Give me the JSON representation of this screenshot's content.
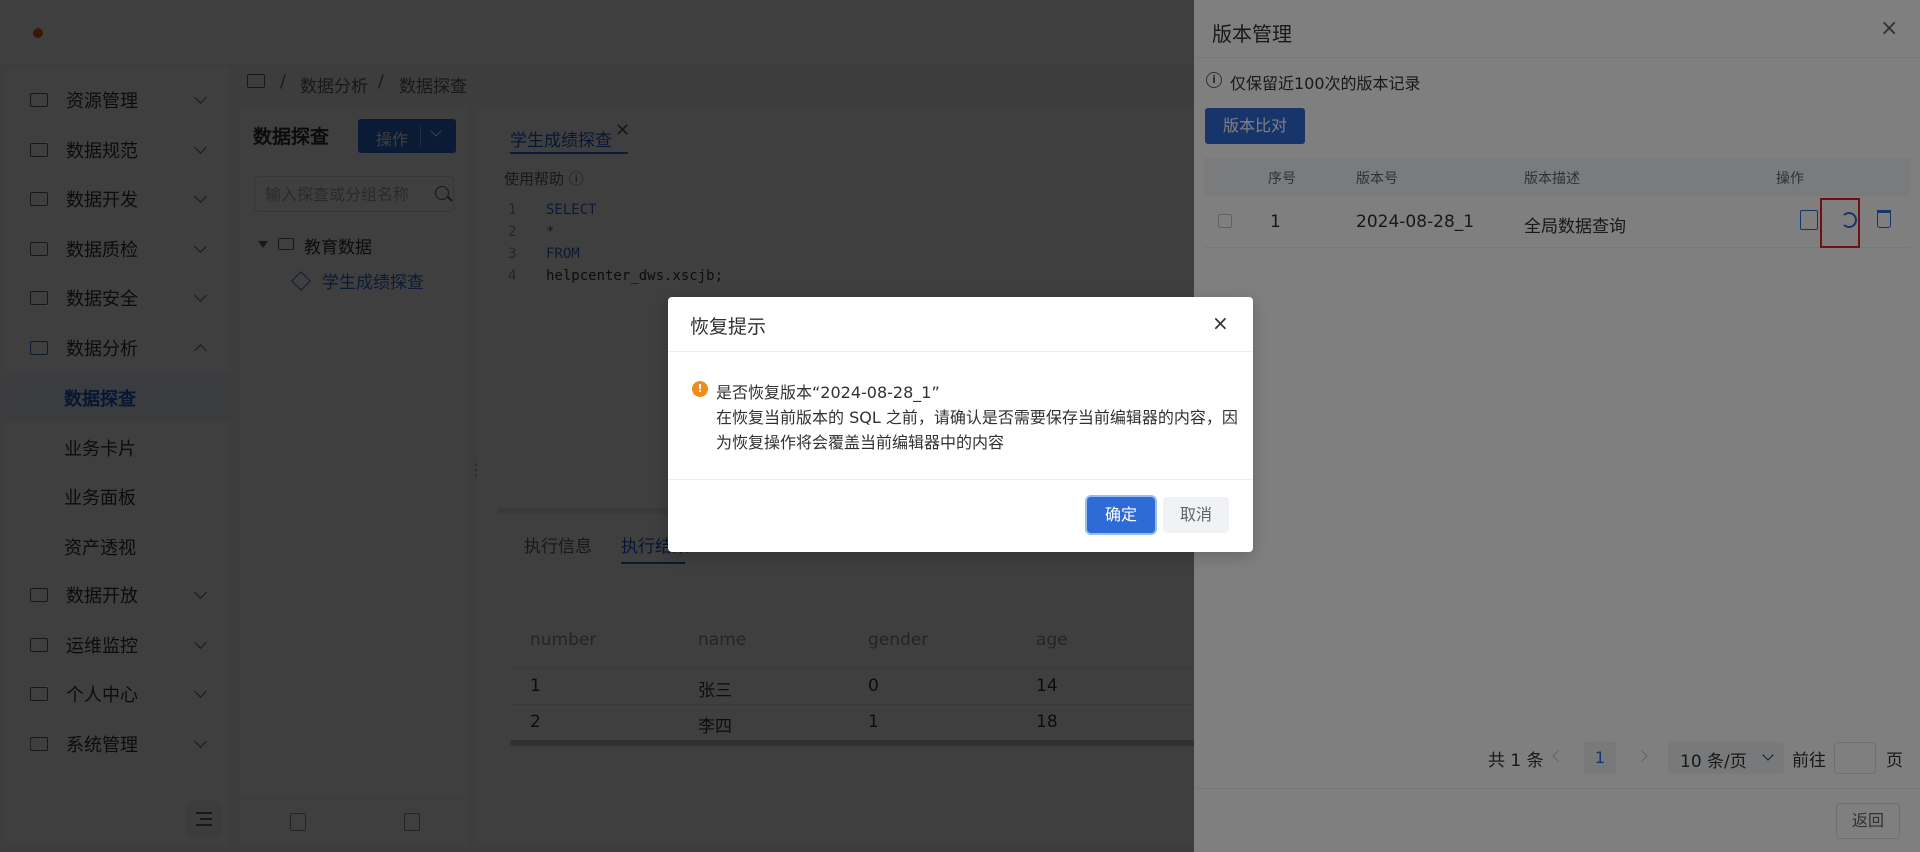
{
  "sidebar": {
    "items": [
      {
        "label": "资源管理"
      },
      {
        "label": "数据规范"
      },
      {
        "label": "数据开发"
      },
      {
        "label": "数据质检"
      },
      {
        "label": "数据安全"
      },
      {
        "label": "数据分析"
      },
      {
        "label": "数据开放"
      },
      {
        "label": "运维监控"
      },
      {
        "label": "个人中心"
      },
      {
        "label": "系统管理"
      }
    ],
    "subitems": [
      {
        "label": "数据探查",
        "active": true
      },
      {
        "label": "业务卡片"
      },
      {
        "label": "业务面板"
      },
      {
        "label": "资产透视"
      }
    ]
  },
  "breadcrumb": {
    "sep": "/",
    "level1": "数据分析",
    "level2": "数据探查"
  },
  "explorer": {
    "title": "数据探查",
    "op_button": "操作",
    "search_placeholder": "输入探查或分组名称",
    "folder": "教育数据",
    "item": "学生成绩探查"
  },
  "editor": {
    "tab": "学生成绩探查",
    "tab_close": "✕",
    "help": "使用帮助 ⓘ",
    "lines": [
      {
        "n": "1",
        "code": "SELECT"
      },
      {
        "n": "2",
        "code": "*"
      },
      {
        "n": "3",
        "code": "FROM"
      },
      {
        "n": "4",
        "code": "helpcenter_dws.xscjb;"
      }
    ],
    "result_tabs": [
      "执行信息",
      "执行结果"
    ],
    "table": {
      "headers": [
        "number",
        "name",
        "gender",
        "age"
      ],
      "rows": [
        [
          "1",
          "张三",
          "0",
          "14"
        ],
        [
          "2",
          "李四",
          "1",
          "18"
        ]
      ]
    }
  },
  "drawer": {
    "title": "版本管理",
    "close": "×",
    "info": "仅保留近100次的版本记录",
    "compare_button": "版本比对",
    "headers": [
      "序号",
      "版本号",
      "版本描述",
      "操作"
    ],
    "row": {
      "index": "1",
      "version": "2024-08-28_1",
      "desc": "全局数据查询"
    },
    "pager": {
      "total": "共 1 条",
      "page": "1",
      "size": "10 条/页",
      "goto": "前往",
      "page_unit": "页"
    },
    "back_button": "返回"
  },
  "dialog": {
    "title": "恢复提示",
    "close": "×",
    "line1": "是否恢复版本“2024-08-28_1”",
    "line2": "在恢复当前版本的 SQL 之前，请确认是否需要保存当前编辑器的内容，因",
    "line3": "为恢复操作将会覆盖当前编辑器中的内容",
    "ok": "确定",
    "cancel": "取消"
  },
  "colors": {
    "accent": "#2f6bd6",
    "warning": "#f08c1a",
    "highlight": "#e02020"
  }
}
